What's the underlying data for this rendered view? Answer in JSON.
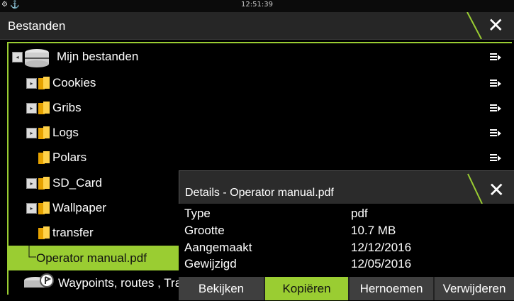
{
  "status": {
    "time": "12:51:39"
  },
  "window": {
    "title": "Bestanden"
  },
  "tree": {
    "root": "Mijn bestanden",
    "items": [
      {
        "label": "Cookies"
      },
      {
        "label": "Gribs"
      },
      {
        "label": "Logs"
      },
      {
        "label": "Polars"
      },
      {
        "label": "SD_Card"
      },
      {
        "label": "Wallpaper"
      },
      {
        "label": "transfer"
      },
      {
        "label": "Operator manual.pdf"
      },
      {
        "label": "Waypoints, routes , Tracks"
      }
    ]
  },
  "details": {
    "title": "Details - Operator manual.pdf",
    "rows": [
      {
        "key": "Type",
        "value": "pdf"
      },
      {
        "key": "Grootte",
        "value": "10.7 MB"
      },
      {
        "key": "Aangemaakt",
        "value": "12/12/2016"
      },
      {
        "key": "Gewijzigd",
        "value": "12/05/2016"
      }
    ],
    "buttons": [
      "Bekijken",
      "Kopiëren",
      "Hernoemen",
      "Verwijderen"
    ],
    "active_button": "Kopiëren"
  },
  "colors": {
    "accent": "#9acd32",
    "folder": "#ffd24a"
  }
}
